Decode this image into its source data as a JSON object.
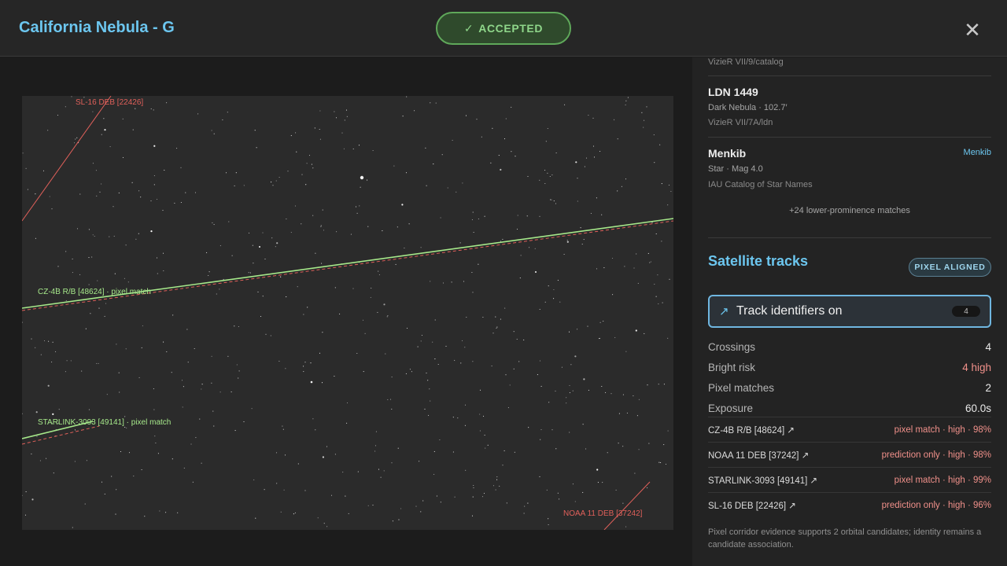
{
  "header": {
    "title": "California Nebula - G",
    "status": "ACCEPTED",
    "check_icon": "check-icon",
    "close_icon": "close-icon"
  },
  "image": {
    "labels": {
      "sl16": "SL-16 DEB [22426]",
      "cz4b": "CZ-4B R/B [48624] · pixel match",
      "starlink": "STARLINK-3093 [49141] · pixel match",
      "noaa": "NOAA 11 DEB [37242]"
    },
    "colors": {
      "prediction": "#e0605a",
      "pixel_match": "#a6e88a"
    }
  },
  "panel": {
    "top_catalog": "VizieR VII/9/catalog",
    "objects": [
      {
        "name": "LDN 1449",
        "meta": "Dark Nebula · 102.7′",
        "catalog": "VizieR VII/7A/ldn",
        "link": ""
      },
      {
        "name": "Menkib",
        "meta": "Star · Mag 4.0",
        "catalog": "IAU Catalog of Star Names",
        "link": "Menkib"
      }
    ],
    "more_matches": "+24 lower-prominence matches",
    "satellite": {
      "title": "Satellite tracks",
      "badge": "PIXEL ALIGNED",
      "toggle_label": "Track identifiers on",
      "toggle_count": "4",
      "stats": [
        {
          "label": "Crossings",
          "value": "4"
        },
        {
          "label": "Bright risk",
          "value": "4 high"
        },
        {
          "label": "Pixel matches",
          "value": "2"
        },
        {
          "label": "Exposure",
          "value": "60.0s"
        }
      ],
      "tracks": [
        {
          "name": "CZ-4B R/B [48624] ↗",
          "status": "pixel match · high · 98%"
        },
        {
          "name": "NOAA 11 DEB [37242] ↗",
          "status": "prediction only · high · 98%"
        },
        {
          "name": "STARLINK-3093 [49141] ↗",
          "status": "pixel match · high · 99%"
        },
        {
          "name": "SL-16 DEB [22426] ↗",
          "status": "prediction only · high · 96%"
        }
      ],
      "footnote": "Pixel corridor evidence supports 2 orbital candidates; identity remains a candidate association."
    }
  }
}
